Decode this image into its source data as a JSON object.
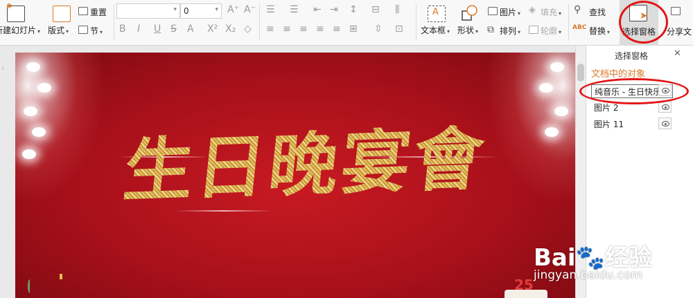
{
  "ribbon": {
    "new_slide_label": "新建幻灯片",
    "layout_label": "版式",
    "reset_label": "重置",
    "section_label": "节",
    "font_name_value": "",
    "font_size_value": "0",
    "textbox_label": "文本框",
    "shape_label": "形状",
    "picture_label": "图片",
    "fill_label": "填充",
    "arrange_label": "排列",
    "outline_label": "轮廓",
    "find_label": "查找",
    "replace_label": "替换",
    "selection_pane_label": "选择窗格",
    "split_label": "分享文"
  },
  "pane": {
    "title": "选择窗格",
    "section_label": "文档中的对象",
    "objects": [
      {
        "label": "纯音乐 - 生日快乐"
      },
      {
        "label": "图片 2"
      },
      {
        "label": "图片 11"
      }
    ]
  },
  "slide": {
    "title": "生日晚宴會",
    "badge": "25"
  },
  "watermark": {
    "brand": "Bai🐾经验",
    "url": "jingyan.baidu.com"
  },
  "colors": {
    "slide_bg": "#b0121c",
    "accent_orange": "#d97a2b",
    "annotation_red": "#e31414",
    "gold": "#d9a93a"
  }
}
